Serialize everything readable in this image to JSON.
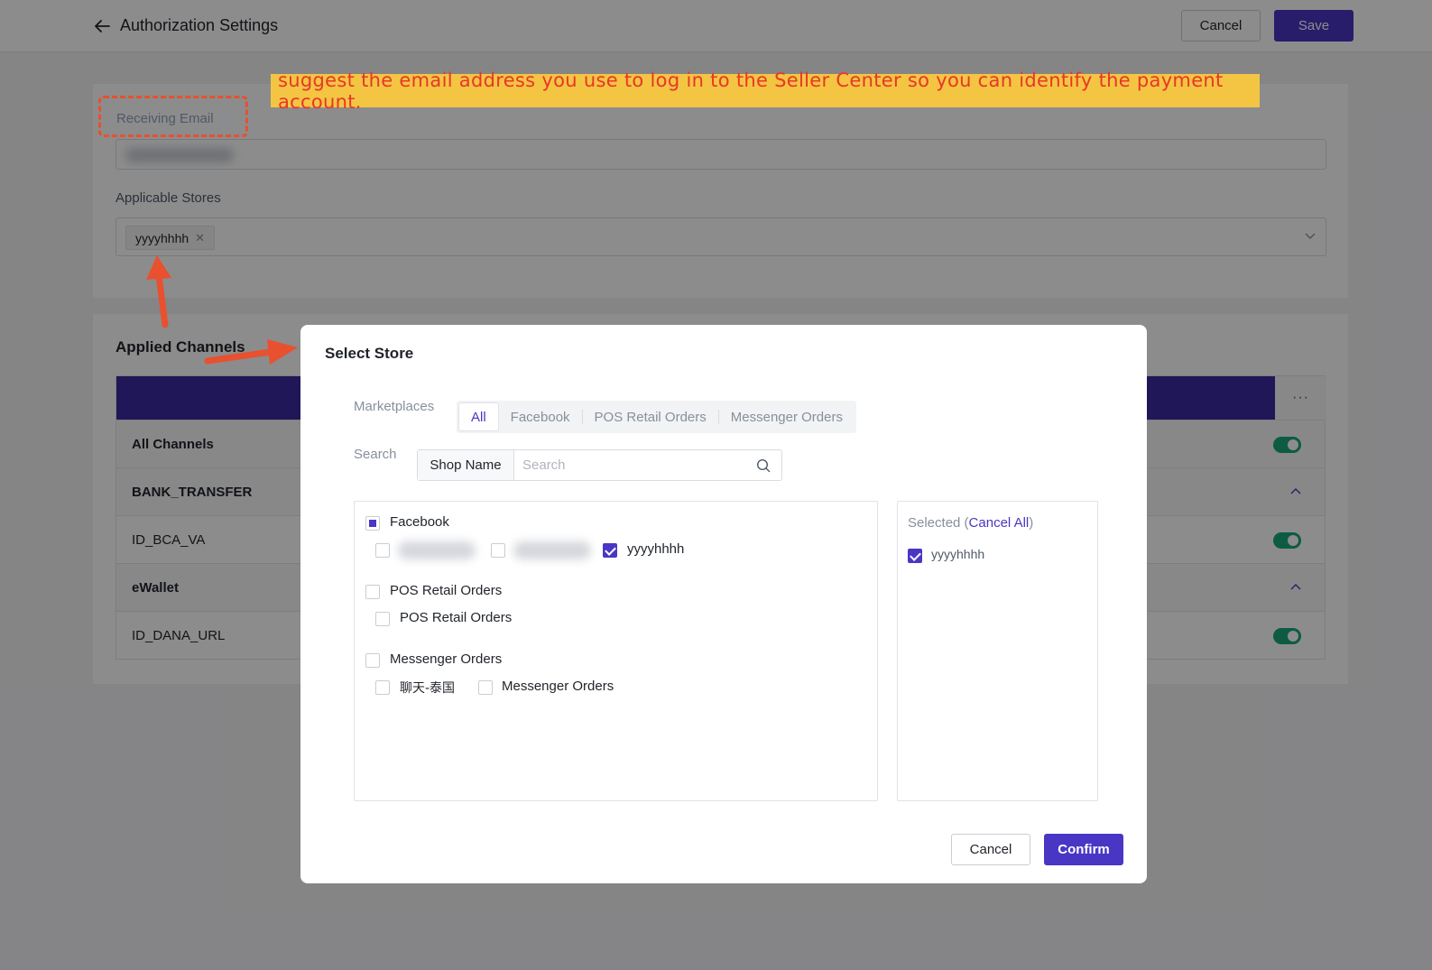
{
  "header": {
    "title": "Authorization Settings",
    "cancel_label": "Cancel",
    "save_label": "Save"
  },
  "form": {
    "receiving_email_label": "Receiving Email",
    "applicable_stores_label": "Applicable Stores",
    "store_tag": "yyyyhhhh",
    "applied_channels_title": "Applied Channels",
    "more_label": "···",
    "rows": [
      {
        "label": "All Channels",
        "group": true
      },
      {
        "label": "BANK_TRANSFER",
        "group": true
      },
      {
        "label": "ID_BCA_VA",
        "group": false
      },
      {
        "label": "eWallet",
        "group": true
      },
      {
        "label": "ID_DANA_URL",
        "group": false
      }
    ]
  },
  "annotation": {
    "banner": "suggest the email address you use to log in to the Seller Center so you can identify the payment account."
  },
  "modal": {
    "title": "Select Store",
    "marketplaces_label": "Marketplaces",
    "tabs": [
      "All",
      "Facebook",
      "POS Retail Orders",
      "Messenger Orders"
    ],
    "search_label": "Search",
    "search_prefix": "Shop Name",
    "search_placeholder": "Search",
    "groups": {
      "facebook": {
        "name": "Facebook",
        "store": "yyyyhhhh"
      },
      "pos": {
        "name": "POS Retail Orders",
        "store": "POS Retail Orders"
      },
      "messenger": {
        "name": "Messenger Orders",
        "store1": "聊天-泰国",
        "store2": "Messenger Orders"
      }
    },
    "selected_label": "Selected (",
    "cancel_all_label": "Cancel All",
    "selected_close": ")",
    "selected_item": "yyyyhhhh",
    "cancel_label": "Cancel",
    "confirm_label": "Confirm"
  },
  "colors": {
    "primary": "#4a36c4",
    "toggle_on": "#1aa67a",
    "annotation_red": "#e8502f",
    "banner_yellow": "#f4c542"
  }
}
